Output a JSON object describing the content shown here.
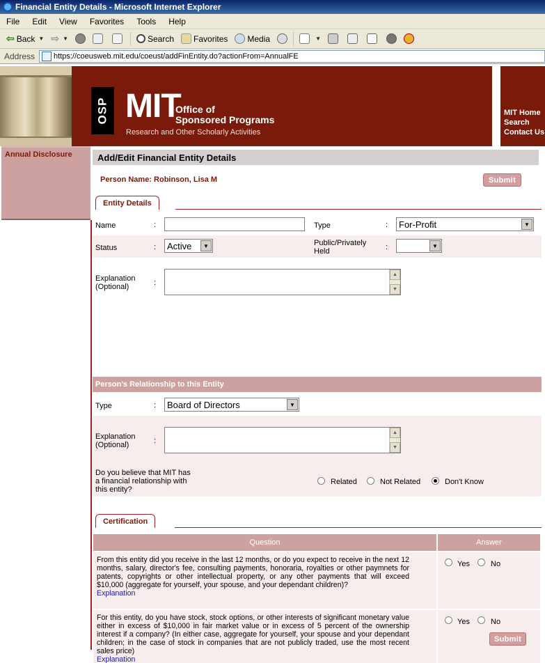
{
  "window": {
    "title": "Financial Entity Details - Microsoft Internet Explorer"
  },
  "menu": [
    "File",
    "Edit",
    "View",
    "Favorites",
    "Tools",
    "Help"
  ],
  "toolbar": {
    "back": "Back",
    "search": "Search",
    "favorites": "Favorites",
    "media": "Media"
  },
  "address": {
    "label": "Address",
    "url": "https://coeusweb.mit.edu/coeust/addFinEntity.do?actionFrom=AnnualFE"
  },
  "banner": {
    "osp": "OSP",
    "mit": "MIT",
    "office_line1": "Office of",
    "office_line2": "Sponsored Programs",
    "subtitle": "Research and Other Scholarly Activities",
    "links": [
      "MIT Home",
      "Search",
      "Contact Us"
    ]
  },
  "sidebar": {
    "annual_disclosure": "Annual Disclosure"
  },
  "page": {
    "title": "Add/Edit Financial Entity Details",
    "person_name": "Person Name: Robinson, Lisa M",
    "submit": "Submit"
  },
  "entity": {
    "tab": "Entity Details",
    "name_label": "Name",
    "name_value": "",
    "type_label": "Type",
    "type_value": "For-Profit",
    "status_label": "Status",
    "status_value": "Active",
    "public_label_1": "Public/Privately",
    "public_label_2": "Held",
    "public_value": "",
    "explanation_label_1": "Explanation",
    "explanation_label_2": "(Optional)",
    "colon": ":"
  },
  "relationship": {
    "header": "Person's Relationship to this Entity",
    "type_label": "Type",
    "type_value": "Board of Directors",
    "explanation_label_1": "Explanation",
    "explanation_label_2": "(Optional)",
    "question_1": "Do you believe that MIT has",
    "question_2": "a financial relationship with",
    "question_3": "this entity?",
    "options": [
      "Related",
      "Not Related",
      "Don't Know"
    ],
    "selected": "Don't Know"
  },
  "certification": {
    "tab": "Certification",
    "question_header": "Question",
    "answer_header": "Answer",
    "yes": "Yes",
    "no": "No",
    "explanation_link": "Explanation",
    "q1": "From this entity did you receive in the last 12 months, or do you expect to receive in the next 12 months, salary, director's fee, consulting payments, honoraria, royalties or other paymnets for patents, copyrights or other intellectual property, or any other payments that will exceed $10,000 (aggregate for yourself, your spouse, and your dependant children)?",
    "q2": "For this entity, do you have stock, stock options, or other interests of significant monetary value either in excess of $10,000 in fair market value or in excess of 5 percent of the ownership interest if a company? (In either case, aggregate for yourself, your spouse and your dependant children; in the case of stock in companies that are not publicly traded, use the most recent sales price)"
  },
  "colors": {
    "maroon": "#7a1a0a",
    "pink": "#cea1a1",
    "shade": "#f7eded",
    "link": "#1a1aa8"
  }
}
